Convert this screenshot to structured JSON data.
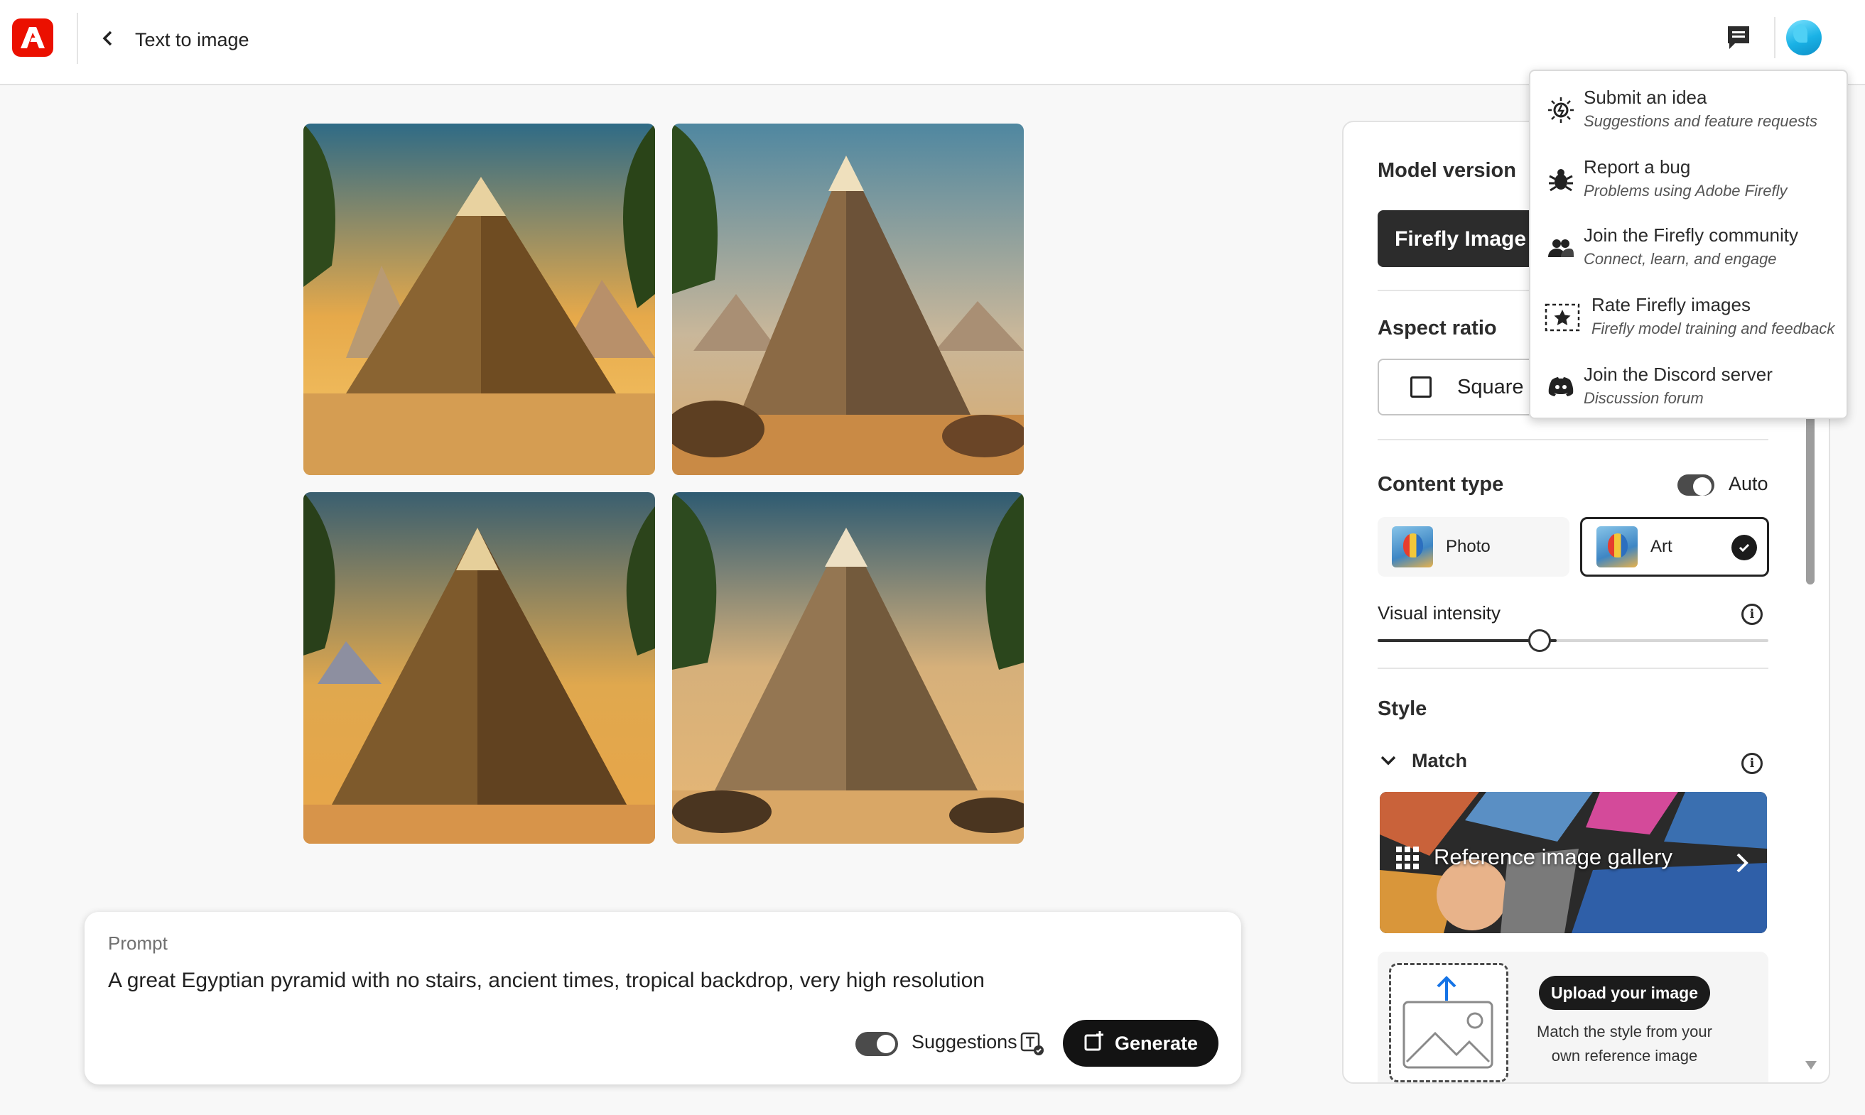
{
  "header": {
    "title": "Text to image",
    "logo_icon": "adobe-logo",
    "feedback_icon": "chat-icon",
    "brand_color": "#eb1000"
  },
  "gallery_images": [
    {
      "alt": "pyramid-1"
    },
    {
      "alt": "pyramid-2"
    },
    {
      "alt": "pyramid-3"
    },
    {
      "alt": "pyramid-4"
    }
  ],
  "prompt": {
    "label": "Prompt",
    "text": "A great Egyptian pyramid with no stairs, ancient times, tropical backdrop, very high resolution",
    "suggestions_label": "Suggestions",
    "suggestions_on": true,
    "generate_label": "Generate"
  },
  "panel": {
    "model_version_title": "Model version",
    "model_button": "Firefly Image 2",
    "aspect_ratio_title": "Aspect ratio",
    "aspect_ratio_value": "Square",
    "content_type_title": "Content type",
    "auto_label": "Auto",
    "auto_on": true,
    "content_types": [
      {
        "label": "Photo",
        "selected": false
      },
      {
        "label": "Art",
        "selected": true
      }
    ],
    "visual_intensity_label": "Visual intensity",
    "visual_intensity_level": 0.5,
    "style_title": "Style",
    "match_label": "Match",
    "gallery_label": "Reference image gallery",
    "upload_button": "Upload your image",
    "upload_desc_1": "Match the style from your",
    "upload_desc_2": "own reference image"
  },
  "menu": {
    "items": [
      {
        "title": "Submit an idea",
        "subtitle": "Suggestions and feature requests",
        "icon": "lightbulb-icon"
      },
      {
        "title": "Report a bug",
        "subtitle": "Problems using Adobe Firefly",
        "icon": "bug-icon"
      },
      {
        "title": "Join the Firefly community",
        "subtitle": "Connect, learn, and engage",
        "icon": "community-icon"
      },
      {
        "title": "Rate Firefly images",
        "subtitle": "Firefly model training and feedback",
        "icon": "star-rating-icon"
      },
      {
        "title": "Join the Discord server",
        "subtitle": "Discussion forum",
        "icon": "discord-icon"
      }
    ]
  }
}
